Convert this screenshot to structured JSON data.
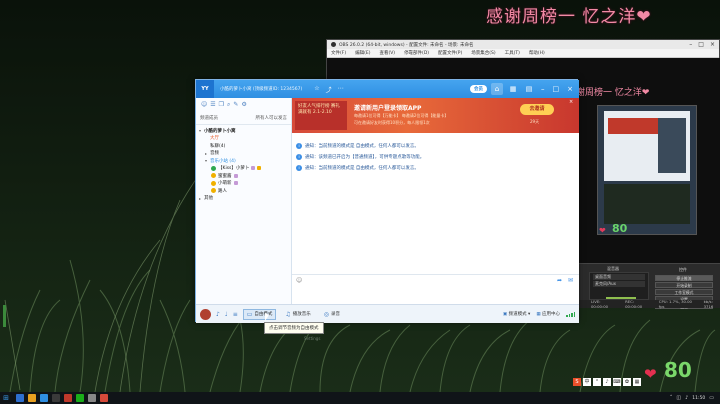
{
  "overlay": {
    "title": "感谢周榜一 忆之洋❤",
    "heart": "❤",
    "count": "80"
  },
  "obs": {
    "title": "OBS 26.0.2 (64-bit, windows) - 配置文件: 未命名 - 场景: 未命名",
    "menu": [
      "文件(F)",
      "编辑(E)",
      "查看(V)",
      "停靠部件(D)",
      "配置文件(P)",
      "场景集合(S)",
      "工具(T)",
      "帮助(H)"
    ],
    "preview_overlay_text": "感谢周榜一 忆之洋❤",
    "mini_count": "80",
    "dock": {
      "mixer_title": "混音器",
      "mixer_rows": [
        "桌面音频",
        "麦克风/Aux"
      ],
      "controls_title": "控件",
      "controls": [
        "停止推流",
        "开始录制",
        "工作室模式",
        "设置",
        "退出"
      ]
    },
    "status": {
      "live": "LIVE: 00:00:00",
      "rec": "REC: 00:00:00",
      "cpu": "CPU: 1.7%, 30.00 fps",
      "kbps": "kb/s: 3716"
    }
  },
  "yy": {
    "logo": "YY",
    "channel_title": "小酷的萝卜小窝 (顶级频道ID: 1234567)",
    "top_pill": "会员",
    "nav": [
      "⌂",
      "▦",
      "▤"
    ],
    "tabs": {
      "left": "频道成员",
      "right": "所有人可以发言"
    },
    "tree": [
      {
        "label": "小酷的萝卜小窝",
        "kind": "channel",
        "level": 0,
        "arrow": "▾"
      },
      {
        "label": "大厅",
        "kind": "hall",
        "level": 1,
        "arrow": ""
      },
      {
        "label": "私聊(4)",
        "kind": "room",
        "level": 1,
        "arrow": ""
      },
      {
        "label": "音频",
        "kind": "room",
        "level": 1,
        "arrow": "▸"
      },
      {
        "label": "音乐小站 (4)",
        "kind": "room",
        "level": 1,
        "arrow": "▾"
      },
      {
        "label": "【Kiss】小萝卜",
        "kind": "user-host",
        "level": 2,
        "arrow": ""
      },
      {
        "label": "蜜蜜酱",
        "kind": "user",
        "level": 2,
        "arrow": ""
      },
      {
        "label": "小萌新",
        "kind": "user",
        "level": 2,
        "arrow": ""
      },
      {
        "label": "路人",
        "kind": "user",
        "level": 2,
        "arrow": ""
      },
      {
        "label": "其他",
        "kind": "channel",
        "level": 0,
        "arrow": "▸"
      }
    ],
    "banner": {
      "left_text": "好友人气排行榜 赛礼满就有 2.1-2.10",
      "app_title": "邀请新用户登录领取APP",
      "line1": "每邀请1位可得【万能卡】 每邀请2位可得【能量卡】",
      "line2": "可在邀请好友时获得10积分，每人限领1次",
      "button": "去邀请",
      "countdown": "29天",
      "close": "×"
    },
    "messages": [
      "通知：当前频道的模式是 自由模式，任何人都可以发言。",
      "通知：该频道已开启为【普通频道】，可供专题点歌等功能。",
      "通知：当前频道的模式是 自由模式，任何人都可以发言。"
    ],
    "bottom": {
      "btn_voice_mode": "自由模式",
      "btn_mixer": "播放音乐",
      "btn_record": "录音",
      "right_mode": "频道模式",
      "right_apps": "应用中心"
    },
    "tooltip": "点击调节音频为自由模式",
    "faint_label": "Settings"
  },
  "taskbar": {
    "start": "⊞",
    "time": "11:50"
  },
  "colors": {
    "yy_blue": "#2f8fe2",
    "overlay_pink": "#f28aa5",
    "count_green": "#7ad86a",
    "heart_red": "#e2304f"
  }
}
